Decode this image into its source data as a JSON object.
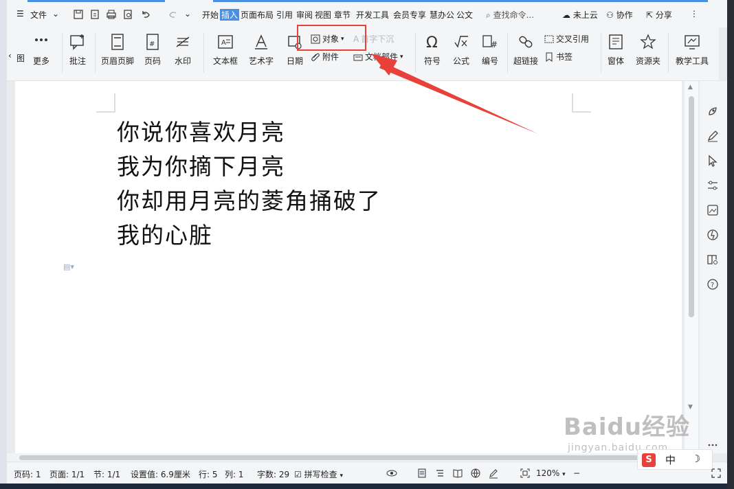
{
  "menu": {
    "file_label": "文件",
    "tabs": [
      "开始",
      "插入",
      "页面布局",
      "引用",
      "审阅",
      "视图",
      "章节",
      "开发工具",
      "会员专享",
      "慧办公",
      "公文"
    ],
    "active_tab": "插入",
    "search_placeholder": "查找命令...",
    "cloud_label": "未上云",
    "collab_label": "协作",
    "share_label": "分享"
  },
  "ribbon": {
    "partial_left_label": "图",
    "more_label": "更多",
    "comment_label": "批注",
    "header_footer_label": "页眉页脚",
    "page_number_label": "页码",
    "watermark_label": "水印",
    "textbox_label": "文本框",
    "wordart_label": "艺术字",
    "date_label": "日期",
    "object_label": "对象",
    "drop_cap_label": "首字下沉",
    "attachment_label": "附件",
    "doc_parts_label": "文档部件",
    "symbol_label": "符号",
    "formula_label": "公式",
    "numbering_label": "编号",
    "hyperlink_label": "超链接",
    "cross_ref_label": "交叉引用",
    "bookmark_label": "书签",
    "window_label": "窗体",
    "resources_label": "资源夹",
    "teaching_label": "教学工具"
  },
  "document": {
    "lines": [
      "你说你喜欢月亮",
      "我为你摘下月亮",
      "你却用月亮的菱角捅破了",
      "我的心脏"
    ]
  },
  "status": {
    "page_code": "页码: 1",
    "page_count": "页面: 1/1",
    "section": "节: 1/1",
    "setting": "设置值: 6.9厘米",
    "row": "行: 5",
    "col": "列: 1",
    "word_count": "字数: 29",
    "spell_check": "拼写检查",
    "zoom": "120%"
  },
  "ime": {
    "logo": "S",
    "lang": "中",
    "mode": "☽"
  },
  "watermark": {
    "brand": "Baidu经验",
    "url": "jingyan.baidu.com"
  },
  "colors": {
    "accent": "#4a90e2",
    "highlight": "#e8413a"
  }
}
